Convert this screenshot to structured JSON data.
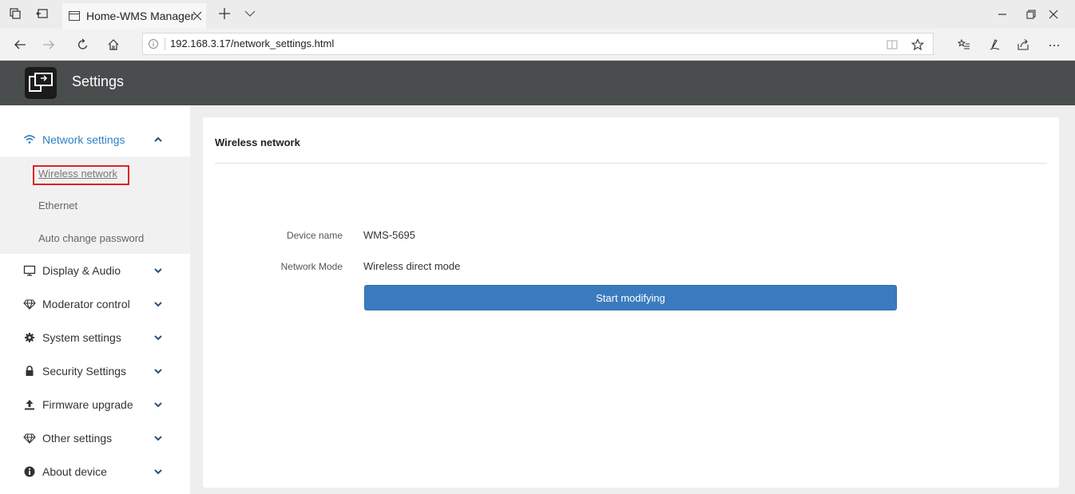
{
  "browser": {
    "tab_title": "Home-WMS Manager",
    "url": "192.168.3.17/network_settings.html"
  },
  "app": {
    "title": "Settings"
  },
  "sidebar": {
    "items": [
      {
        "label": "Network settings",
        "icon": "wifi-icon",
        "expanded": true
      },
      {
        "label": "Display & Audio",
        "icon": "monitor-icon"
      },
      {
        "label": "Moderator control",
        "icon": "diamond-icon"
      },
      {
        "label": "System settings",
        "icon": "gear-icon"
      },
      {
        "label": "Security Settings",
        "icon": "lock-icon"
      },
      {
        "label": "Firmware upgrade",
        "icon": "upload-icon"
      },
      {
        "label": "Other settings",
        "icon": "diamond-icon"
      },
      {
        "label": "About device",
        "icon": "info-icon"
      }
    ],
    "subitems": [
      {
        "label": "Wireless network",
        "current": true
      },
      {
        "label": "Ethernet"
      },
      {
        "label": "Auto change password"
      }
    ]
  },
  "card": {
    "title": "Wireless network",
    "fields": [
      {
        "label": "Device name",
        "value": "WMS-5695"
      },
      {
        "label": "Network Mode",
        "value": "Wireless direct mode"
      }
    ],
    "button_label": "Start modifying"
  },
  "colors": {
    "header_bg": "#4a4d4d",
    "accent": "#2f7fc1",
    "button": "#3a7bbf",
    "highlight": "#e02323"
  }
}
